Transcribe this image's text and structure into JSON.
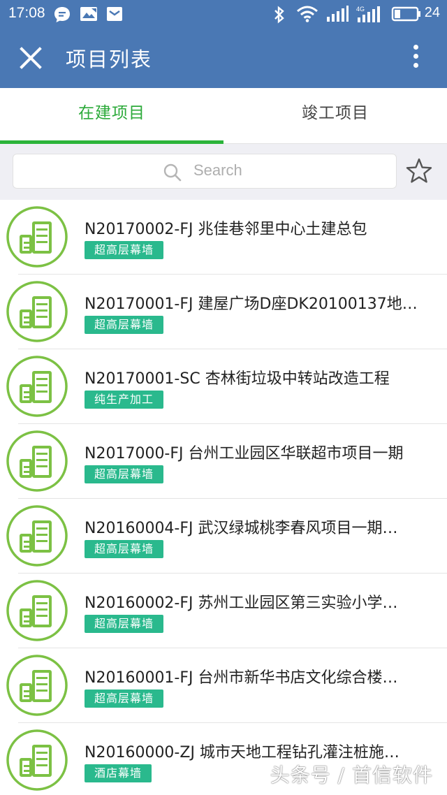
{
  "status_bar": {
    "time": "17:08",
    "battery": "24",
    "left_icons": [
      "message-bubble-icon",
      "image-icon",
      "mail-icon"
    ],
    "right_icons": [
      "bluetooth-icon",
      "wifi-icon",
      "signal-icon",
      "signal-4g-icon",
      "battery-icon"
    ]
  },
  "app_bar": {
    "title": "项目列表",
    "close_icon": "close-icon",
    "menu_icon": "more-vertical-icon"
  },
  "tabs": [
    {
      "label": "在建项目",
      "active": true
    },
    {
      "label": "竣工项目",
      "active": false
    }
  ],
  "search": {
    "placeholder": "Search",
    "favorite_icon": "star-outline-icon"
  },
  "projects": [
    {
      "title": "N20170002-FJ 兆佳巷邻里中心土建总包",
      "tag": "超高层幕墙"
    },
    {
      "title": "N20170001-FJ 建屋广场D座DK20100137地…",
      "tag": "超高层幕墙"
    },
    {
      "title": "N20170001-SC 杏林街垃圾中转站改造工程",
      "tag": "纯生产加工"
    },
    {
      "title": "N2017000-FJ 台州工业园区华联超市项目一期",
      "tag": "超高层幕墙"
    },
    {
      "title": "N20160004-FJ 武汉绿城桃李春风项目一期…",
      "tag": "超高层幕墙"
    },
    {
      "title": "N20160002-FJ 苏州工业园区第三实验小学…",
      "tag": "超高层幕墙"
    },
    {
      "title": "N20160001-FJ 台州市新华书店文化综合楼…",
      "tag": "超高层幕墙"
    },
    {
      "title": "N20160000-ZJ 城市天地工程钻孔灌注桩施…",
      "tag": "酒店幕墙"
    }
  ],
  "watermark": "头条号 / 首信软件",
  "colors": {
    "primary": "#4a78b4",
    "accent_green": "#2caa3a",
    "badge": "#2ab98d",
    "avatar_ring": "#7cc144"
  }
}
